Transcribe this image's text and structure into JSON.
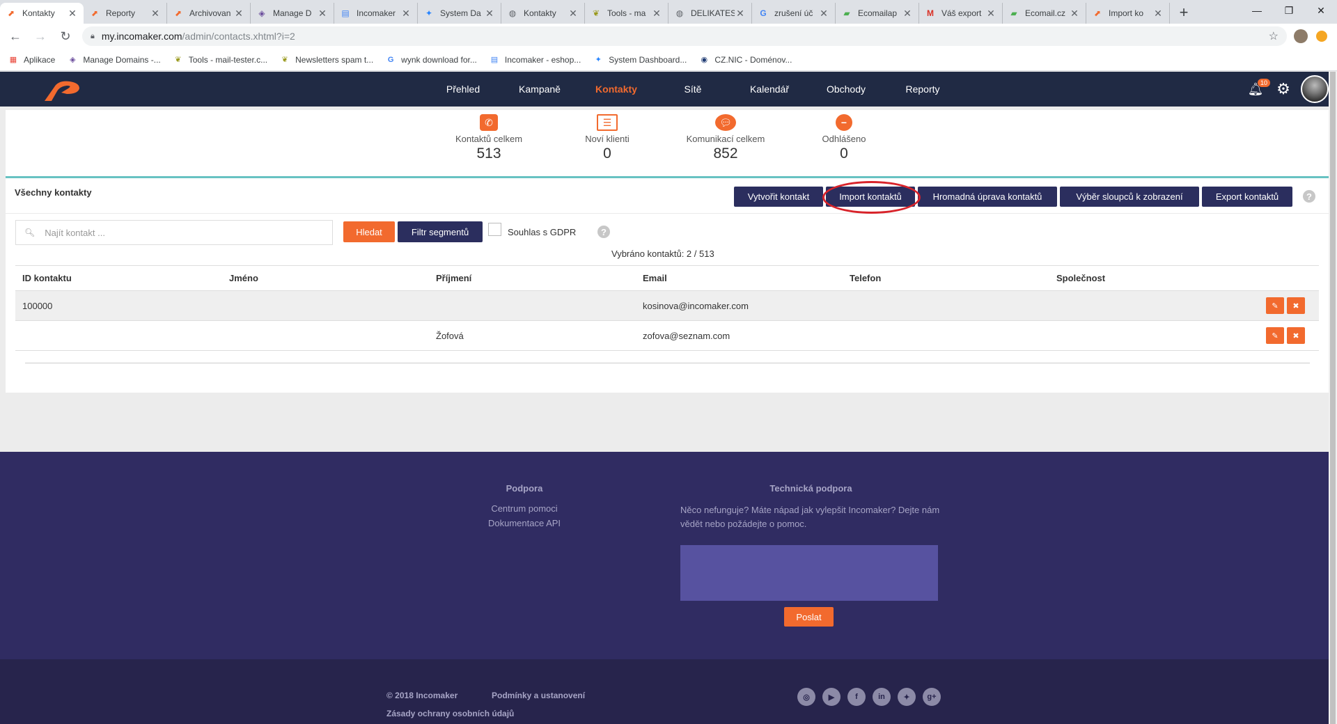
{
  "browser": {
    "tabs": [
      {
        "title": "Kontakty",
        "icon": "incomaker-logo-icon",
        "active": true
      },
      {
        "title": "Reporty",
        "icon": "incomaker-logo-icon"
      },
      {
        "title": "Archivovan",
        "icon": "incomaker-logo-icon"
      },
      {
        "title": "Manage D",
        "icon": "manage-domains-icon"
      },
      {
        "title": "Incomaker",
        "icon": "docs-icon"
      },
      {
        "title": "System Da",
        "icon": "jira-icon"
      },
      {
        "title": "Kontakty",
        "icon": "globe-icon"
      },
      {
        "title": "Tools - ma",
        "icon": "leaf-icon"
      },
      {
        "title": "DELIKATES",
        "icon": "globe-icon"
      },
      {
        "title": "zrušení úč",
        "icon": "google-icon"
      },
      {
        "title": "Ecomailap",
        "icon": "ecomail-icon"
      },
      {
        "title": "Váš export",
        "icon": "gmail-icon"
      },
      {
        "title": "Ecomail.cz",
        "icon": "ecomail-icon"
      },
      {
        "title": "Import ko",
        "icon": "incomaker-logo-icon"
      }
    ],
    "close_glyph": "✕",
    "new_tab_glyph": "+",
    "url_host": "my.incomaker.com",
    "url_path": "/admin/contacts.xhtml?i=2",
    "bookmarks": [
      {
        "label": "Aplikace",
        "icon": "apps-grid-icon"
      },
      {
        "label": "Manage Domains -...",
        "icon": "manage-domains-icon"
      },
      {
        "label": "Tools - mail-tester.c...",
        "icon": "leaf-icon"
      },
      {
        "label": "Newsletters spam t...",
        "icon": "leaf-icon"
      },
      {
        "label": "wynk download for...",
        "icon": "google-icon"
      },
      {
        "label": "Incomaker - eshop...",
        "icon": "docs-icon"
      },
      {
        "label": "System Dashboard...",
        "icon": "jira-icon"
      },
      {
        "label": "CZ.NIC - Doménov...",
        "icon": "cznic-icon"
      }
    ]
  },
  "nav": {
    "items": [
      "Přehled",
      "Kampaně",
      "Kontakty",
      "Sítě",
      "Kalendář",
      "Obchody",
      "Reporty"
    ],
    "active_index": 2,
    "notification_count": "10"
  },
  "stats": [
    {
      "label": "Kontaktů celkem",
      "value": "513",
      "icon": "phone-icon"
    },
    {
      "label": "Noví klienti",
      "value": "0",
      "icon": "list-icon"
    },
    {
      "label": "Komunikací celkem",
      "value": "852",
      "icon": "chat-icon"
    },
    {
      "label": "Odhlášeno",
      "value": "0",
      "icon": "minus-circle-icon"
    }
  ],
  "section": {
    "title": "Všechny kontakty",
    "buttons": [
      "Vytvořit kontakt",
      "Import kontaktů",
      "Hromadná úprava kontaktů",
      "Výběr sloupců k zobrazení",
      "Export kontaktů"
    ]
  },
  "search": {
    "placeholder": "Najít kontakt ...",
    "search_button": "Hledat",
    "segment_button": "Filtr segmentů",
    "gdpr_label": "Souhlas s GDPR",
    "selected_info": "Vybráno kontaktů: 2 / 513"
  },
  "table": {
    "columns": [
      "ID kontaktu",
      "Jméno",
      "Příjmení",
      "Email",
      "Telefon",
      "Společnost"
    ],
    "rows": [
      {
        "id": "100000",
        "first": "",
        "last": "",
        "email": "kosinova@incomaker.com",
        "phone": "",
        "company": ""
      },
      {
        "id": "",
        "first": "",
        "last": "Žofová",
        "email": "zofova@seznam.com",
        "phone": "",
        "company": ""
      }
    ]
  },
  "footer": {
    "support_title": "Podpora",
    "support_links": [
      "Centrum pomoci",
      "Dokumentace API"
    ],
    "tech_title": "Technická podpora",
    "tech_text": "Něco nefunguje? Máte nápad jak vylepšit Incomaker? Dejte nám vědět nebo požádejte o pomoc.",
    "send_button": "Poslat",
    "copyright": "© 2018 Incomaker",
    "terms": "Podmínky a ustanovení",
    "privacy": "Zásady ochrany osobních údajů",
    "social": [
      "instagram-icon",
      "youtube-icon",
      "facebook-icon",
      "linkedin-icon",
      "twitter-icon",
      "google-plus-icon"
    ]
  },
  "colors": {
    "nav_bg": "#202a44",
    "accent_orange": "#f26a2e",
    "button_navy": "#2b2e5e",
    "teal_line": "#67c2c2",
    "footer_bg": "#302c62",
    "annotation_red": "#d8232a"
  }
}
